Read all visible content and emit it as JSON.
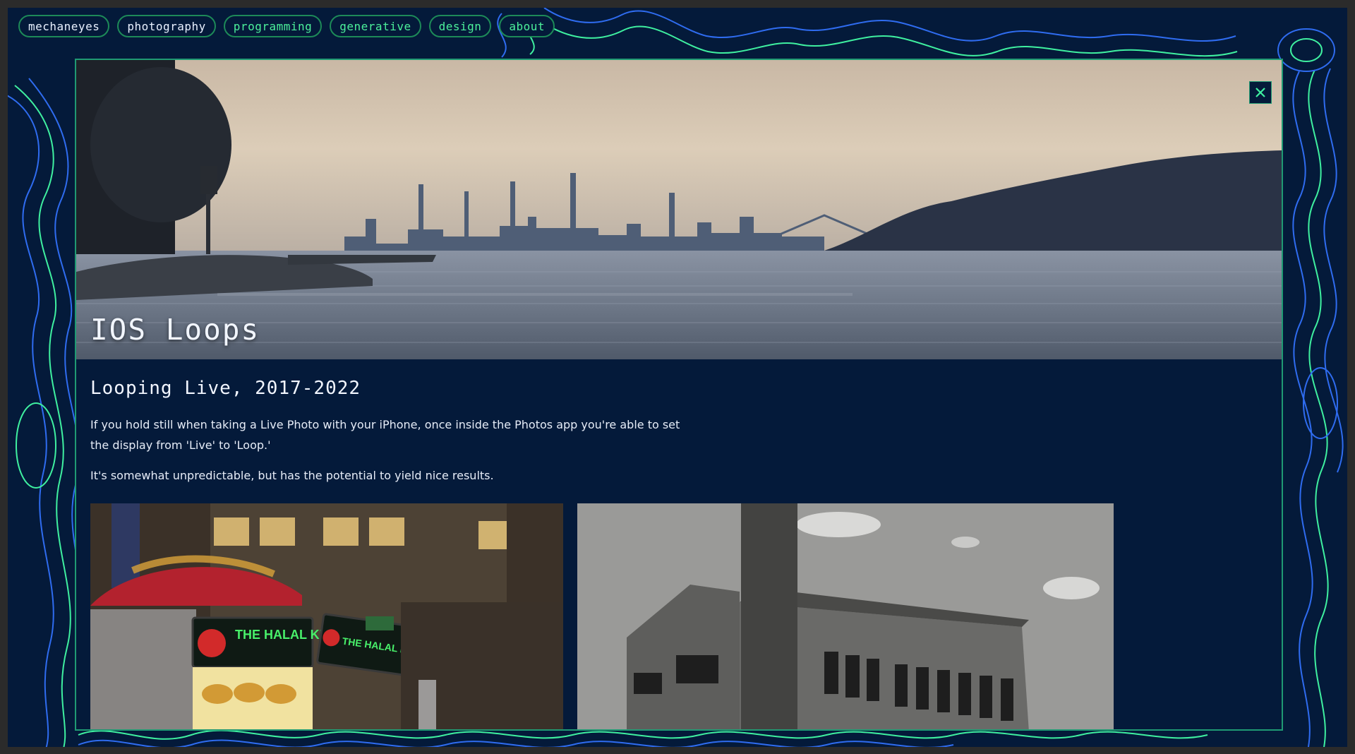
{
  "nav": {
    "items": [
      {
        "label": "mechaneyes"
      },
      {
        "label": "photography"
      },
      {
        "label": "programming"
      },
      {
        "label": "generative"
      },
      {
        "label": "design"
      },
      {
        "label": "about"
      }
    ]
  },
  "modal": {
    "hero_title": "IOS Loops",
    "close_icon": "close-icon",
    "subtitle": "Looping Live, 2017-2022",
    "paragraphs": [
      "If you hold still when taking a Live Photo with your iPhone, once inside the Photos app you're able to set the display from 'Live' to 'Loop.'",
      "It's somewhat unpredictable, but has the potential to yield nice results."
    ],
    "photos": {
      "first_sign_main": "THE HALAL KITCHEN",
      "first_sign_side": "THE HALAL KITCHEN"
    }
  },
  "colors": {
    "background": "#041a3a",
    "accent_green": "#3ff0a0",
    "contour_blue": "#2f6cf0",
    "text": "#f2f6ff"
  }
}
